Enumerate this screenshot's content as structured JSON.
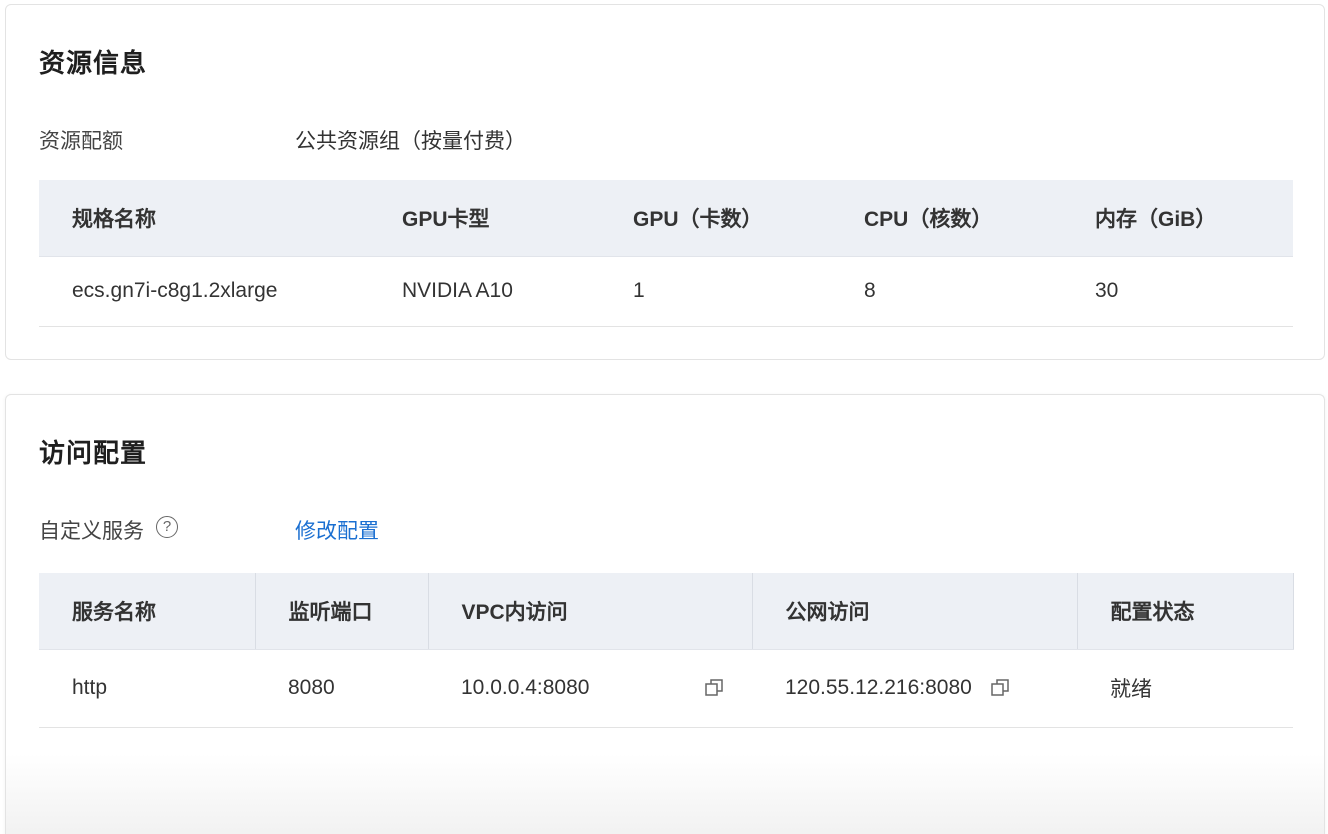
{
  "resource_section": {
    "title": "资源信息",
    "quota_label": "资源配额",
    "quota_value": "公共资源组（按量付费）",
    "columns": [
      "规格名称",
      "GPU卡型",
      "GPU（卡数）",
      "CPU（核数）",
      "内存（GiB）"
    ],
    "rows": [
      [
        "ecs.gn7i-c8g1.2xlarge",
        "NVIDIA A10",
        "1",
        "8",
        "30"
      ]
    ]
  },
  "access_section": {
    "title": "访问配置",
    "custom_service_label": "自定义服务",
    "help_icon": "question-circle-icon",
    "modify_link": "修改配置",
    "columns": [
      "服务名称",
      "监听端口",
      "VPC内访问",
      "公网访问",
      "配置状态"
    ],
    "rows": [
      {
        "name": "http",
        "port": "8080",
        "vpc": "10.0.0.4:8080",
        "public": "120.55.12.216:8080",
        "status": "就绪"
      }
    ]
  },
  "colors": {
    "link": "#1a6fd1",
    "table_header_bg": "#edf0f5"
  }
}
